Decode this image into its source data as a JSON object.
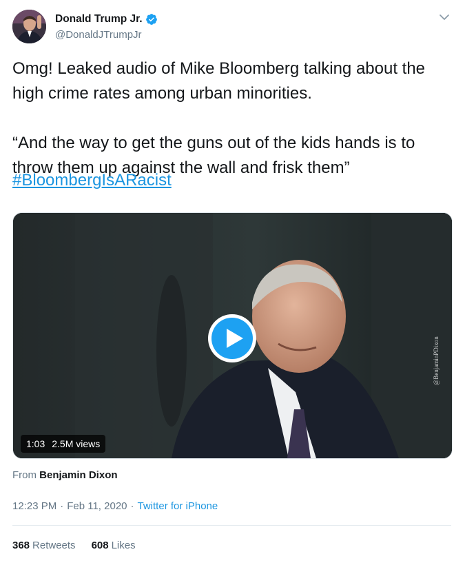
{
  "author": {
    "display_name": "Donald Trump Jr.",
    "handle": "@DonaldJTrumpJr",
    "verified": true
  },
  "tweet": {
    "text": "Omg! Leaked audio of Mike Bloomberg talking about the high crime rates among urban minorities.\n\n“And the way to get the guns out of the kids hands is to throw them up against the wall and frisk them”",
    "hashtag": "#BloombergIsARacist"
  },
  "media": {
    "duration": "1:03",
    "views": "2.5M views",
    "watermark": "@BenjaminPDixon"
  },
  "attribution": {
    "prefix": "From",
    "source_name": "Benjamin Dixon"
  },
  "meta": {
    "time": "12:23 PM",
    "date": "Feb 11, 2020",
    "separator": "·",
    "client": "Twitter for iPhone"
  },
  "stats": {
    "retweets_count": "368",
    "retweets_label": "Retweets",
    "likes_count": "608",
    "likes_label": "Likes"
  },
  "colors": {
    "link": "#1b95e0",
    "secondary_text": "#657786",
    "play_button": "#1da1f2"
  },
  "icons": [
    "verified-badge-icon",
    "chevron-down-icon",
    "play-icon"
  ]
}
